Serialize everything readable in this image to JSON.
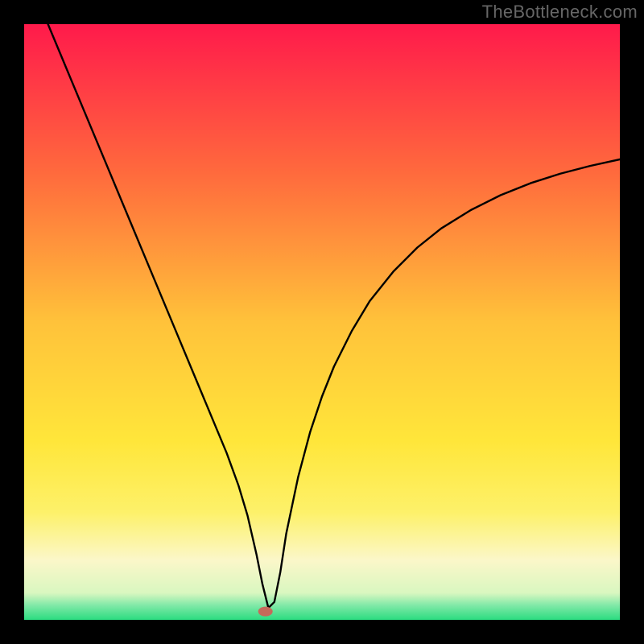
{
  "watermark": "TheBottleneck.com",
  "chart_data": {
    "type": "line",
    "title": "",
    "xlabel": "",
    "ylabel": "",
    "xlim": [
      0,
      100
    ],
    "ylim": [
      0,
      100
    ],
    "grid": false,
    "legend": false,
    "background_gradient_stops": [
      {
        "offset": 0.0,
        "color": "#ff1a4b"
      },
      {
        "offset": 0.25,
        "color": "#ff6a3d"
      },
      {
        "offset": 0.5,
        "color": "#ffc23a"
      },
      {
        "offset": 0.7,
        "color": "#ffe63a"
      },
      {
        "offset": 0.82,
        "color": "#fdf16a"
      },
      {
        "offset": 0.9,
        "color": "#fbf7c9"
      },
      {
        "offset": 0.955,
        "color": "#d9f7c0"
      },
      {
        "offset": 0.975,
        "color": "#83e9a8"
      },
      {
        "offset": 1.0,
        "color": "#2bdc80"
      }
    ],
    "series": [
      {
        "name": "bottleneck-curve",
        "color": "#000000",
        "stroke_width": 2.4,
        "x": [
          4,
          6,
          8,
          10,
          12,
          14,
          16,
          18,
          20,
          22,
          24,
          26,
          28,
          30,
          32,
          34,
          36,
          37.5,
          39,
          40,
          41,
          42,
          43,
          44,
          46,
          48,
          50,
          52,
          55,
          58,
          62,
          66,
          70,
          75,
          80,
          85,
          90,
          95,
          100
        ],
        "y": [
          100,
          95.2,
          90.4,
          85.6,
          80.8,
          76.0,
          71.2,
          66.4,
          61.6,
          56.8,
          52.0,
          47.2,
          42.4,
          37.6,
          32.8,
          28.0,
          22.5,
          17.5,
          11.0,
          6.0,
          2.0,
          3.0,
          8.0,
          14.5,
          24.0,
          31.5,
          37.5,
          42.5,
          48.5,
          53.5,
          58.5,
          62.5,
          65.7,
          68.8,
          71.3,
          73.3,
          74.9,
          76.2,
          77.3
        ]
      }
    ],
    "marker": {
      "name": "bottleneck-marker",
      "x": 40.5,
      "y": 1.4,
      "color": "#c66a5a",
      "rx": 9,
      "ry": 6
    }
  }
}
